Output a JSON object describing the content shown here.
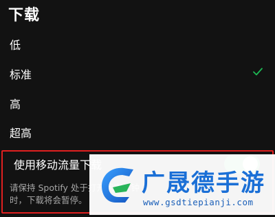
{
  "download": {
    "title": "下载",
    "options": [
      {
        "label": "低",
        "selected": false
      },
      {
        "label": "标准",
        "selected": true
      },
      {
        "label": "高",
        "selected": false
      },
      {
        "label": "超高",
        "selected": false
      }
    ],
    "mobile_data": {
      "label": "使用移动流量下载",
      "enabled": true,
      "description": "请保持 Spotify 处于打开状态，钟时，下载将会暂停。"
    }
  },
  "watermark": {
    "name": "广晟德手游",
    "url": "www.gsdtiepianji.com"
  },
  "colors": {
    "background": "#121212",
    "accent": "#1db954",
    "highlight_border": "#e02020",
    "watermark_blue": "#1a6fd6"
  },
  "icons": {
    "check": "check-icon",
    "logo": "watermark-logo-icon"
  }
}
